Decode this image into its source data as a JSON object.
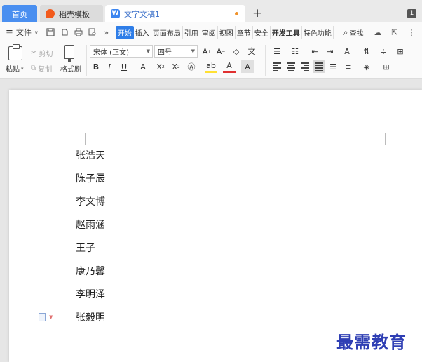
{
  "tabs": {
    "home": "首页",
    "template": "稻壳模板",
    "document": "文字文稿1",
    "doc_icon": "W",
    "new_tab": "+",
    "page_count": "1"
  },
  "menu": {
    "file": "文件",
    "tabs": [
      "开始",
      "插入",
      "页面布局",
      "引用",
      "审阅",
      "视图",
      "章节",
      "安全",
      "开发工具",
      "特色功能"
    ],
    "search": "查找"
  },
  "ribbon": {
    "paste": "粘贴",
    "cut": "剪切",
    "copy": "复制",
    "format_painter": "格式刷",
    "font_name": "宋体 (正文)",
    "font_size": "四号"
  },
  "document": {
    "names": [
      "张浩天",
      "陈子辰",
      "李文博",
      "赵雨涵",
      "王子",
      "康乃馨",
      "李明泽",
      "张毅明"
    ]
  },
  "watermark": "最需教育",
  "colors": {
    "accent": "#2f7ee8",
    "home_tab": "#4a8ff0",
    "watermark": "#2f3fb4"
  }
}
